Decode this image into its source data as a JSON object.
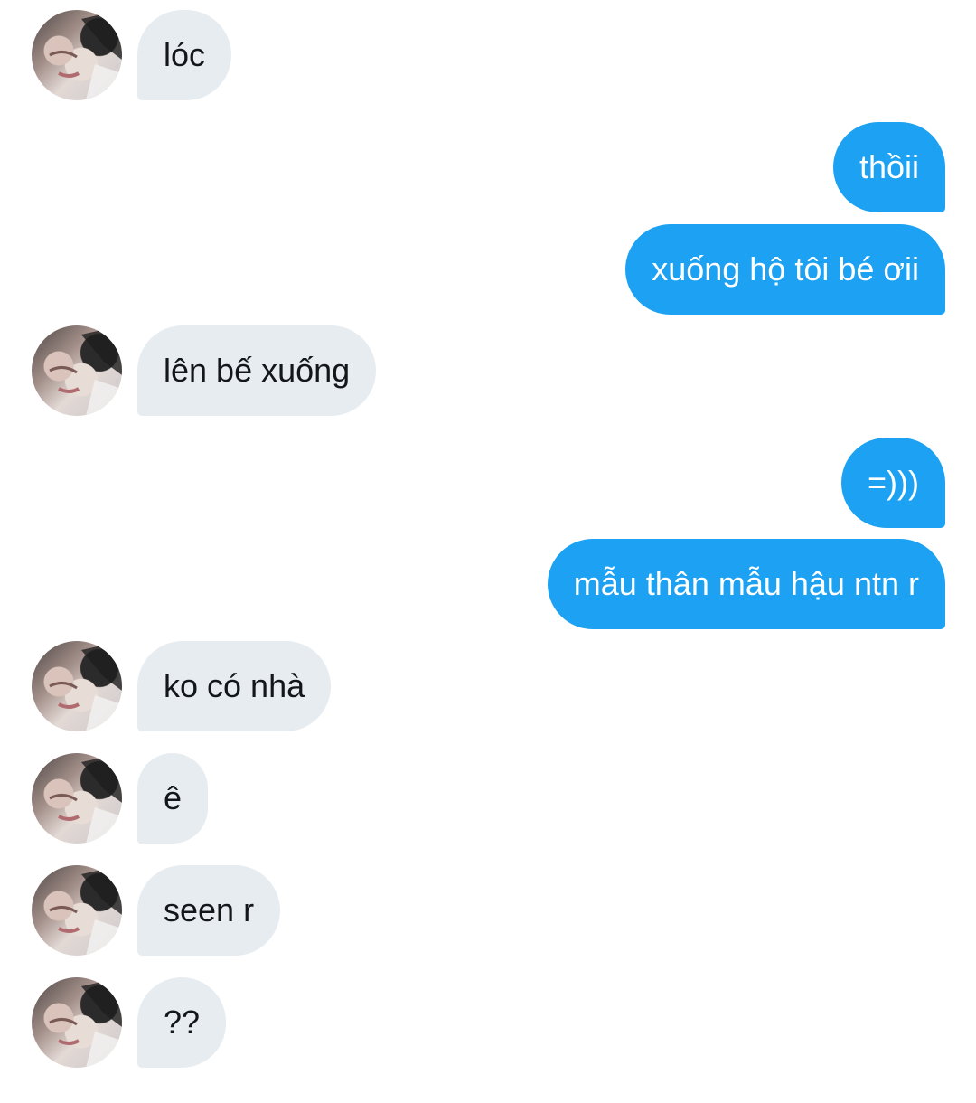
{
  "conversation": {
    "messages": [
      {
        "text": "lóc",
        "from": "them"
      },
      {
        "text": "thồii",
        "from": "me"
      },
      {
        "text": "xuống hộ tôi bé ơii",
        "from": "me"
      },
      {
        "text": "lên bế xuống",
        "from": "them"
      },
      {
        "text": "=)))",
        "from": "me"
      },
      {
        "text": "mẫu thân mẫu hậu ntn r",
        "from": "me"
      },
      {
        "text": "ko có nhà",
        "from": "them"
      },
      {
        "text": "ê",
        "from": "them"
      },
      {
        "text": "seen r",
        "from": "them"
      },
      {
        "text": "??",
        "from": "them"
      }
    ]
  },
  "colors": {
    "incoming_bubble": "#e6ecf0",
    "outgoing_bubble": "#1da1f2",
    "incoming_text": "#14171a",
    "outgoing_text": "#ffffff"
  },
  "icons": {
    "avatar": "user-avatar-photo"
  }
}
